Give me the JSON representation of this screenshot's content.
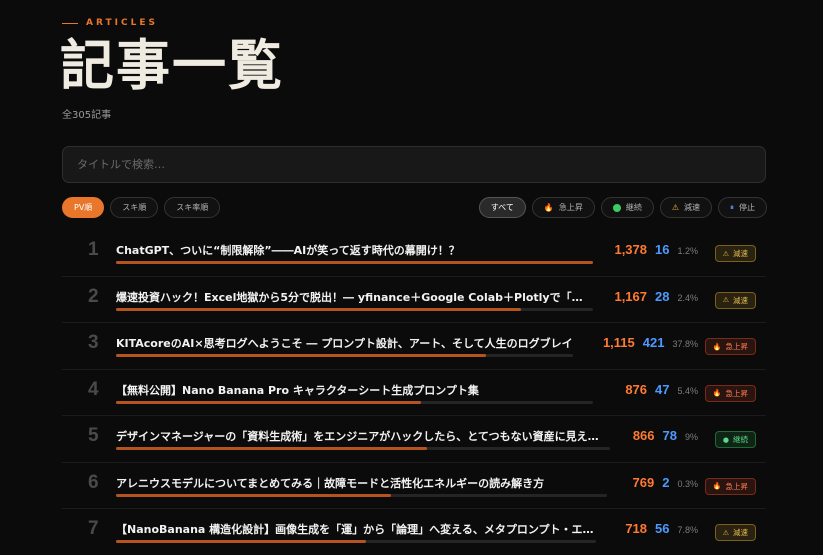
{
  "header": {
    "eyebrow": "ARTICLES",
    "title": "記事一覧",
    "count": "全305記事"
  },
  "search": {
    "placeholder": "タイトルで検索…"
  },
  "sort_tabs": [
    {
      "label": "PV順",
      "active": true
    },
    {
      "label": "スキ順",
      "active": false
    },
    {
      "label": "スキ率順",
      "active": false
    }
  ],
  "filters": [
    {
      "label": "すべて",
      "icon": "",
      "active": true
    },
    {
      "label": "急上昇",
      "icon": "fire-icon"
    },
    {
      "label": "継続",
      "icon": "green-dot-icon"
    },
    {
      "label": "減速",
      "icon": "warning-icon"
    },
    {
      "label": "停止",
      "icon": "pause-icon"
    }
  ],
  "articles": [
    {
      "rank": "1",
      "title": "ChatGPT、ついに“制限解除”――AIが笑って返す時代の幕開け！？",
      "views": "1,378",
      "likes": "16",
      "rate": "1.2%",
      "status": "減速",
      "status_type": "warn",
      "bar": 1.0
    },
    {
      "rank": "2",
      "title": "爆速投資ハック！Excel地獄から5分で脱出！― yfinance＋Google Colab＋Plotlyで「取る…",
      "views": "1,167",
      "likes": "28",
      "rate": "2.4%",
      "status": "減速",
      "status_type": "warn",
      "bar": 0.85
    },
    {
      "rank": "3",
      "title": "KITAcoreのAI×思考ログへようこそ ― プロンプト設計、アート、そして人生のログブレイ",
      "views": "1,115",
      "likes": "421",
      "rate": "37.8%",
      "status": "急上昇",
      "status_type": "rise",
      "bar": 0.81
    },
    {
      "rank": "4",
      "title": "【無料公開】Nano Banana Pro キャラクターシート生成プロンプト集",
      "views": "876",
      "likes": "47",
      "rate": "5.4%",
      "status": "急上昇",
      "status_type": "rise",
      "bar": 0.64
    },
    {
      "rank": "5",
      "title": "デザインマネージャーの「資料生成術」をエンジニアがハックしたら、とてつもない資産に見え…",
      "views": "866",
      "likes": "78",
      "rate": "9%",
      "status": "継続",
      "status_type": "cont",
      "bar": 0.63
    },
    {
      "rank": "6",
      "title": "アレニウスモデルについてまとめてみる｜故障モードと活性化エネルギーの読み解き方",
      "views": "769",
      "likes": "2",
      "rate": "0.3%",
      "status": "急上昇",
      "status_type": "rise",
      "bar": 0.56
    },
    {
      "rank": "7",
      "title": "【NanoBanana 構造化設計】画像生成を「運」から「論理」へ変える、メタプロンプト・エ…",
      "views": "718",
      "likes": "56",
      "rate": "7.8%",
      "status": "減速",
      "status_type": "warn",
      "bar": 0.52
    }
  ]
}
